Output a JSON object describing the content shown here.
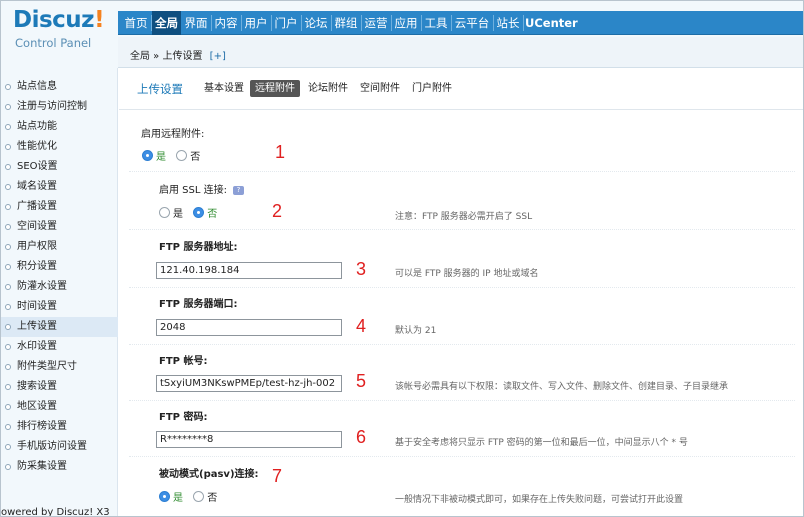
{
  "logo": {
    "name": "Discuz",
    "bang": "!",
    "subtitle": "Control Panel"
  },
  "nav": [
    {
      "label": "首页",
      "active": false
    },
    {
      "label": "全局",
      "active": true
    },
    {
      "label": "界面",
      "active": false
    },
    {
      "label": "内容",
      "active": false
    },
    {
      "label": "用户",
      "active": false
    },
    {
      "label": "门户",
      "active": false
    },
    {
      "label": "论坛",
      "active": false
    },
    {
      "label": "群组",
      "active": false
    },
    {
      "label": "运营",
      "active": false
    },
    {
      "label": "应用",
      "active": false
    },
    {
      "label": "工具",
      "active": false
    },
    {
      "label": "云平台",
      "active": false
    },
    {
      "label": "站长",
      "active": false
    },
    {
      "label": "UCenter",
      "active": false
    }
  ],
  "breadcrumb": {
    "text": "全局 » 上传设置",
    "plus": "[+]"
  },
  "sidebar": {
    "items": [
      {
        "label": "站点信息"
      },
      {
        "label": "注册与访问控制"
      },
      {
        "label": "站点功能"
      },
      {
        "label": "性能优化"
      },
      {
        "label": "SEO设置"
      },
      {
        "label": "域名设置"
      },
      {
        "label": "广播设置"
      },
      {
        "label": "空间设置"
      },
      {
        "label": "用户权限"
      },
      {
        "label": "积分设置"
      },
      {
        "label": "防灌水设置"
      },
      {
        "label": "时间设置"
      },
      {
        "label": "上传设置"
      },
      {
        "label": "水印设置"
      },
      {
        "label": "附件类型尺寸"
      },
      {
        "label": "搜索设置"
      },
      {
        "label": "地区设置"
      },
      {
        "label": "排行榜设置"
      },
      {
        "label": "手机版访问设置"
      },
      {
        "label": "防采集设置"
      }
    ],
    "active_index": 12,
    "powered": "owered by Discuz! X3"
  },
  "tabs": {
    "title": "上传设置",
    "items": [
      "基本设置",
      "远程附件",
      "论坛附件",
      "空间附件",
      "门户附件"
    ],
    "active_index": 1
  },
  "form": {
    "remote": {
      "label": "启用远程附件:",
      "yes": "是",
      "no": "否",
      "selected": "yes",
      "marker": "1"
    },
    "ssl": {
      "label": "启用 SSL 连接:",
      "help": "?",
      "yes": "是",
      "no": "否",
      "selected": "no",
      "marker": "2",
      "tip": "注意：FTP 服务器必需开启了 SSL"
    },
    "host": {
      "label": "FTP 服务器地址:",
      "value": "121.40.198.184",
      "marker": "3",
      "tip": "可以是 FTP 服务器的 IP 地址或域名"
    },
    "port": {
      "label": "FTP 服务器端口:",
      "value": "2048",
      "marker": "4",
      "tip": "默认为 21"
    },
    "user": {
      "label": "FTP 帐号:",
      "value": "tSxyiUM3NKswPMEp/test-hz-jh-002",
      "marker": "5",
      "tip": "该帐号必需具有以下权限：读取文件、写入文件、删除文件、创建目录、子目录继承"
    },
    "pass": {
      "label": "FTP 密码:",
      "value": "R********8",
      "marker": "6",
      "tip": "基于安全考虑将只显示 FTP 密码的第一位和最后一位，中间显示八个 * 号"
    },
    "pasv": {
      "label": "被动模式(pasv)连接:",
      "yes": "是",
      "no": "否",
      "selected": "yes",
      "marker": "7",
      "tip": "一般情况下非被动模式即可，如果存在上传失败问题，可尝试打开此设置"
    }
  }
}
